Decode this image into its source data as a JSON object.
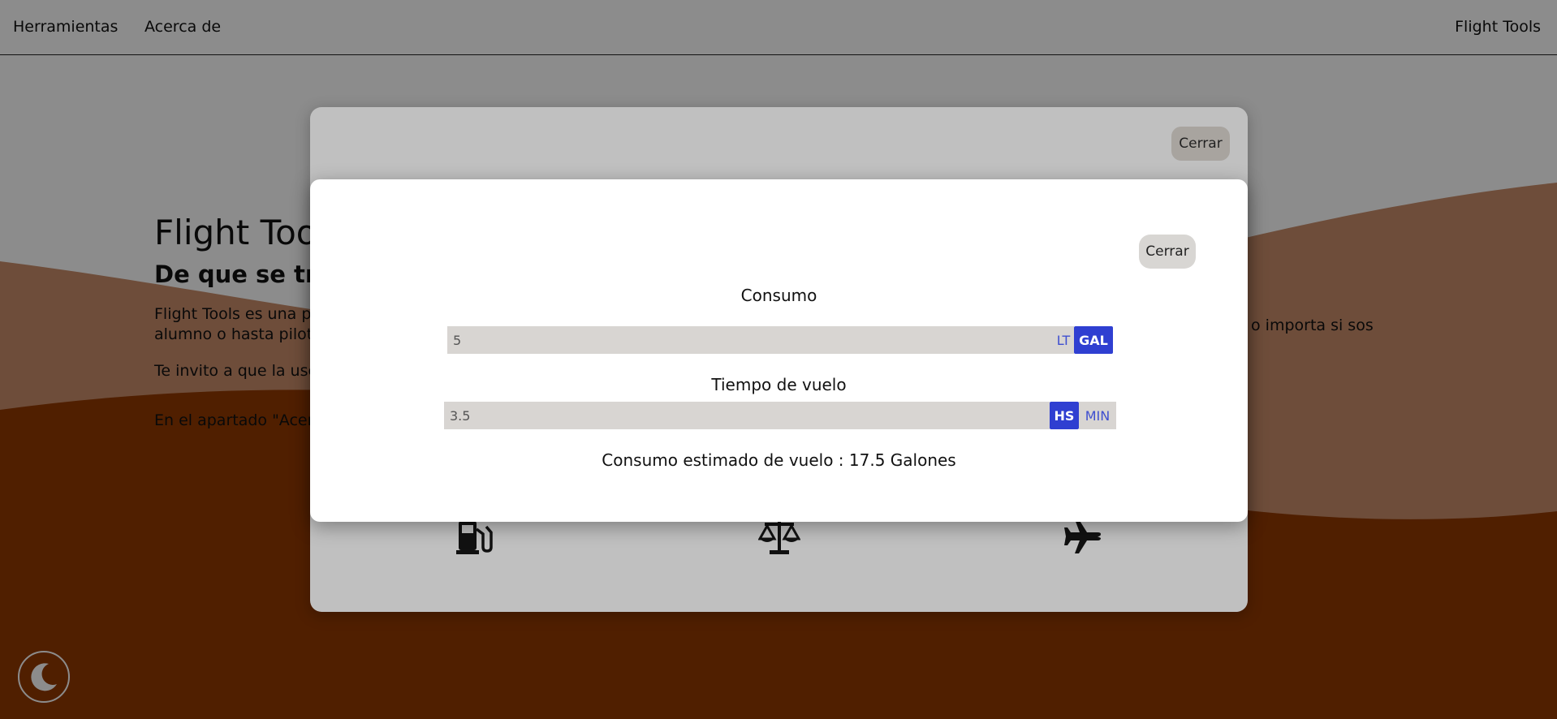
{
  "navbar": {
    "links": [
      "Herramientas",
      "Acerca de"
    ],
    "brand": "Flight Tools"
  },
  "hero": {
    "title": "Flight Tool",
    "subtitle": "De que se trat",
    "paragraph1_left": "Flight Tools es una p",
    "paragraph1_left2": "alumno o hasta pilot",
    "paragraph1_right": "o importa si sos",
    "paragraph2": "Te invito a que la use",
    "paragraph3": "En el apartado \"Acer"
  },
  "colors": {
    "orange_dark": "#933a00",
    "orange_light": "#c88d6b",
    "accent_blue": "#2f3fd1"
  },
  "back_modal": {
    "close_label": "Cerrar",
    "tools": [
      {
        "icon": "gas-pump-icon"
      },
      {
        "icon": "scale-balance-icon"
      },
      {
        "icon": "airplane-icon"
      }
    ]
  },
  "front_modal": {
    "close_label": "Cerrar",
    "consumo_label": "Consumo",
    "consumo_value": "5",
    "consumo_units": {
      "lt": "LT",
      "gal": "GAL",
      "selected": "GAL"
    },
    "tiempo_label": "Tiempo de vuelo",
    "tiempo_value": "3.5",
    "tiempo_units": {
      "hs": "HS",
      "min": "MIN",
      "selected": "HS"
    },
    "result": "Consumo estimado de vuelo : 17.5 Galones"
  },
  "theme_toggle": {
    "icon": "moon-icon"
  }
}
